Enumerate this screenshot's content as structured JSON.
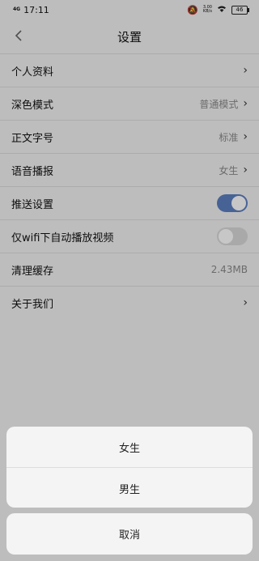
{
  "status": {
    "network": "4G",
    "time": "17:11",
    "speed_top": "3.00",
    "speed_bottom": "KB/s",
    "battery": "46"
  },
  "header": {
    "title": "设置"
  },
  "settings": [
    {
      "label": "个人资料",
      "value": ""
    },
    {
      "label": "深色模式",
      "value": "普通模式"
    },
    {
      "label": "正文字号",
      "value": "标准"
    },
    {
      "label": "语音播报",
      "value": "女生"
    },
    {
      "label": "推送设置",
      "value": ""
    },
    {
      "label": "仅wifi下自动播放视频",
      "value": ""
    },
    {
      "label": "清理缓存",
      "value": "2.43MB"
    },
    {
      "label": "关于我们",
      "value": ""
    }
  ],
  "sheet": {
    "options": [
      "女生",
      "男生"
    ],
    "cancel": "取消"
  },
  "colors": {
    "toggle_on": "#5c7fc0",
    "toggle_off": "#d9d9d9"
  }
}
